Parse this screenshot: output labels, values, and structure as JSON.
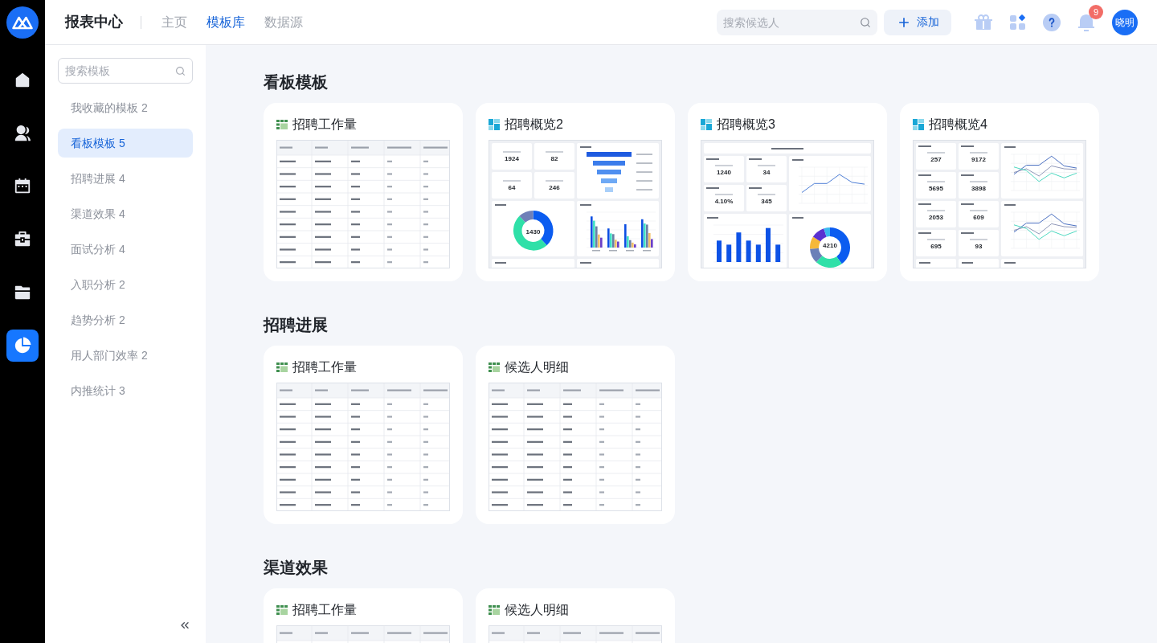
{
  "rail": {
    "items": [
      {
        "selected": false
      },
      {
        "selected": false
      },
      {
        "selected": false
      },
      {
        "selected": false
      },
      {
        "selected": false
      },
      {
        "selected": true
      }
    ]
  },
  "header": {
    "title": "报表中心",
    "tabs": [
      {
        "label": "主页",
        "selected": false
      },
      {
        "label": "模板库",
        "selected": true
      },
      {
        "label": "数据源",
        "selected": false
      }
    ],
    "search": {
      "placeholder": "搜索候选人"
    },
    "add_button": {
      "label": "添加"
    },
    "notifications": {
      "badge": "9"
    },
    "avatar": {
      "label": "晓明"
    }
  },
  "sidebar": {
    "search": {
      "placeholder": "搜索模板"
    },
    "items": [
      {
        "label": "我收藏的模板 2",
        "selected": false
      },
      {
        "label": "看板模板 5",
        "selected": true
      },
      {
        "label": "招聘进展 4",
        "selected": false
      },
      {
        "label": "渠道效果 4",
        "selected": false
      },
      {
        "label": "面试分析 4",
        "selected": false
      },
      {
        "label": "入职分析 2",
        "selected": false
      },
      {
        "label": "趋势分析 2",
        "selected": false
      },
      {
        "label": "用人部门效率 2",
        "selected": false
      },
      {
        "label": "内推统计 3",
        "selected": false
      }
    ]
  },
  "sections": [
    {
      "title": "看板模板",
      "cards": [
        {
          "title": "招聘工作量",
          "kind": "table",
          "preview": {
            "kind": "table"
          }
        },
        {
          "title": "招聘概览2",
          "kind": "dashboard",
          "preview": {
            "kind": "funnel_donut",
            "kpis": [
              {
                "value": "1924"
              },
              {
                "value": "82"
              },
              {
                "value": "64"
              },
              {
                "value": "246"
              }
            ],
            "total": "1430"
          }
        },
        {
          "title": "招聘概览3",
          "kind": "dashboard",
          "preview": {
            "kind": "line_bar_donut",
            "kpis": [
              {
                "value": "1240"
              },
              {
                "value": "34"
              },
              {
                "value": "4.10%"
              },
              {
                "value": "345"
              }
            ],
            "total": "4210"
          }
        },
        {
          "title": "招聘概览4",
          "kind": "dashboard",
          "preview": {
            "kind": "lines",
            "kpis": [
              {
                "value": "257"
              },
              {
                "value": "9172"
              },
              {
                "value": "5695"
              },
              {
                "value": "3898"
              },
              {
                "value": "2053"
              },
              {
                "value": "609"
              },
              {
                "value": "695"
              },
              {
                "value": "93"
              }
            ]
          }
        }
      ]
    },
    {
      "title": "招聘进展",
      "cards": [
        {
          "title": "招聘工作量",
          "kind": "table",
          "preview": {
            "kind": "table"
          }
        },
        {
          "title": "候选人明细",
          "kind": "table",
          "preview": {
            "kind": "table"
          }
        }
      ]
    },
    {
      "title": "渠道效果",
      "cards": [
        {
          "title": "招聘工作量",
          "kind": "table",
          "preview": {
            "kind": "table"
          }
        },
        {
          "title": "候选人明细",
          "kind": "table",
          "preview": {
            "kind": "table"
          }
        }
      ]
    }
  ]
}
